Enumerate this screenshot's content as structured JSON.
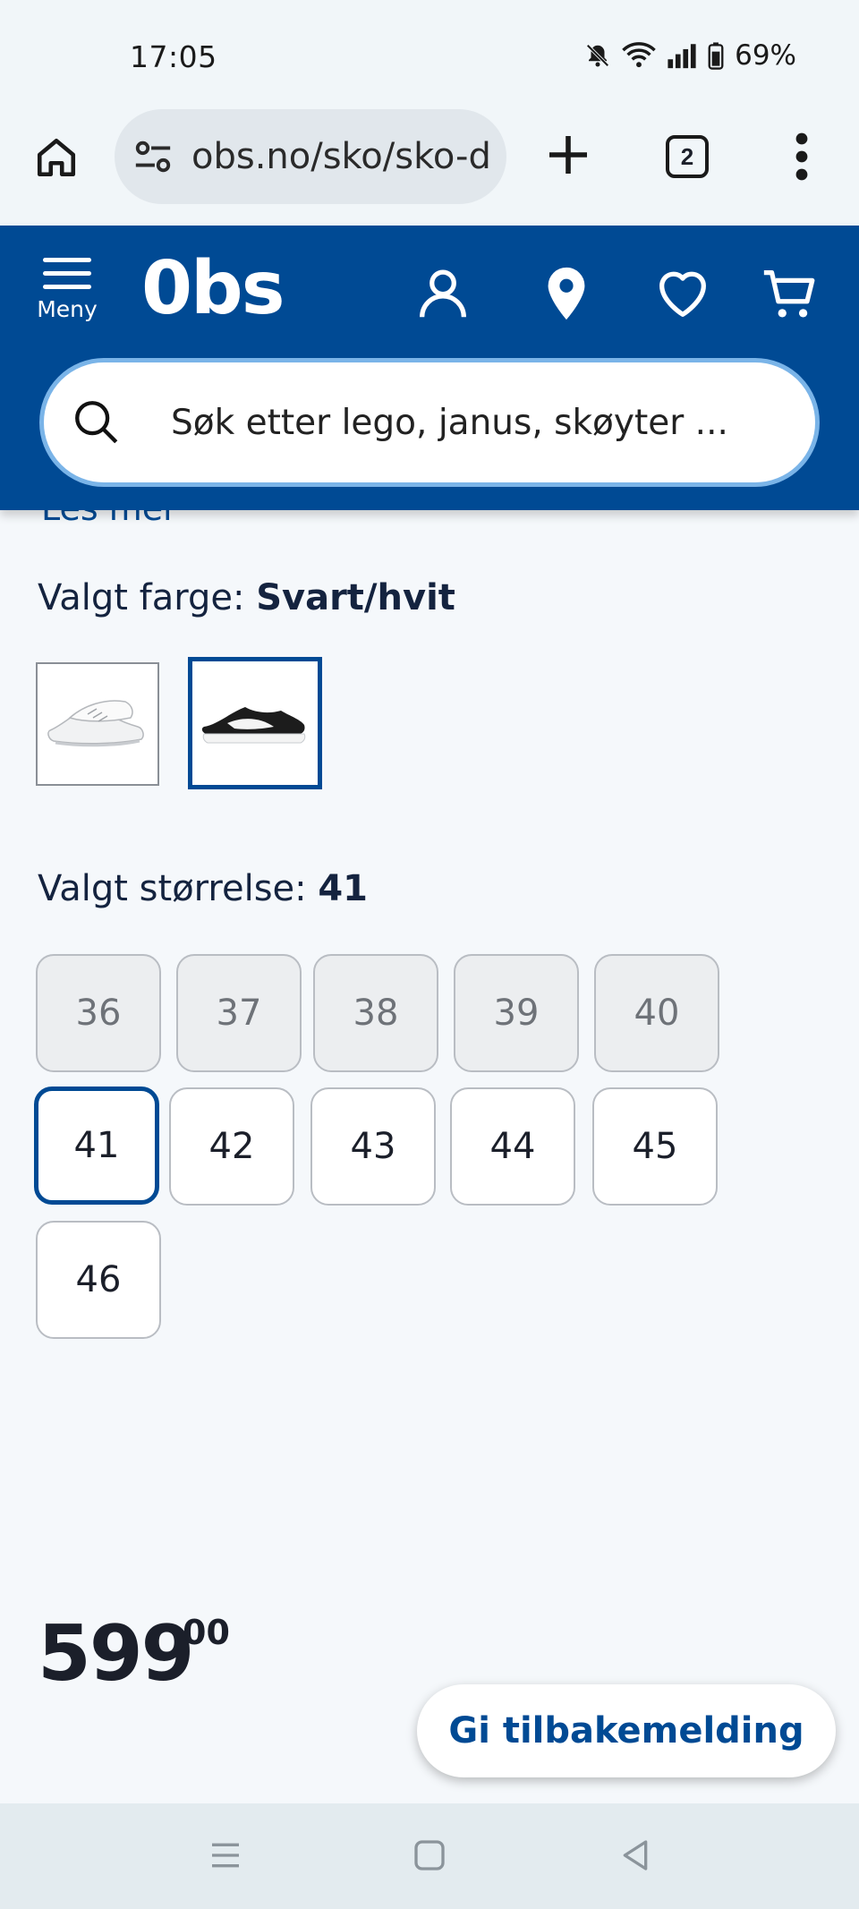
{
  "status_bar": {
    "time": "17:05",
    "battery": "69%"
  },
  "browser": {
    "url": "obs.no/sko/sko-d",
    "tab_count": "2"
  },
  "header": {
    "menu_label": "Meny",
    "logo": "0bs",
    "search_placeholder": "Søk etter lego, janus, skøyter ..."
  },
  "product": {
    "peek_text": "Les mer",
    "color_label": "Valgt farge: ",
    "color_value": "Svart/hvit",
    "swatches": [
      {
        "name": "white-shoe",
        "selected": false
      },
      {
        "name": "black-white-shoe",
        "selected": true
      }
    ],
    "size_label": "Valgt størrelse: ",
    "size_value": "41",
    "sizes": [
      {
        "label": "36",
        "state": "disabled"
      },
      {
        "label": "37",
        "state": "disabled"
      },
      {
        "label": "38",
        "state": "disabled"
      },
      {
        "label": "39",
        "state": "disabled"
      },
      {
        "label": "40",
        "state": "disabled"
      },
      {
        "label": "41",
        "state": "selected"
      },
      {
        "label": "42",
        "state": "available"
      },
      {
        "label": "43",
        "state": "available"
      },
      {
        "label": "44",
        "state": "available"
      },
      {
        "label": "45",
        "state": "available"
      },
      {
        "label": "46",
        "state": "available"
      }
    ],
    "price_main": "599",
    "price_cents": "00"
  },
  "feedback_label": "Gi tilbakemelding",
  "colors": {
    "brand_blue": "#004a94",
    "search_border": "#7ab4e8"
  }
}
